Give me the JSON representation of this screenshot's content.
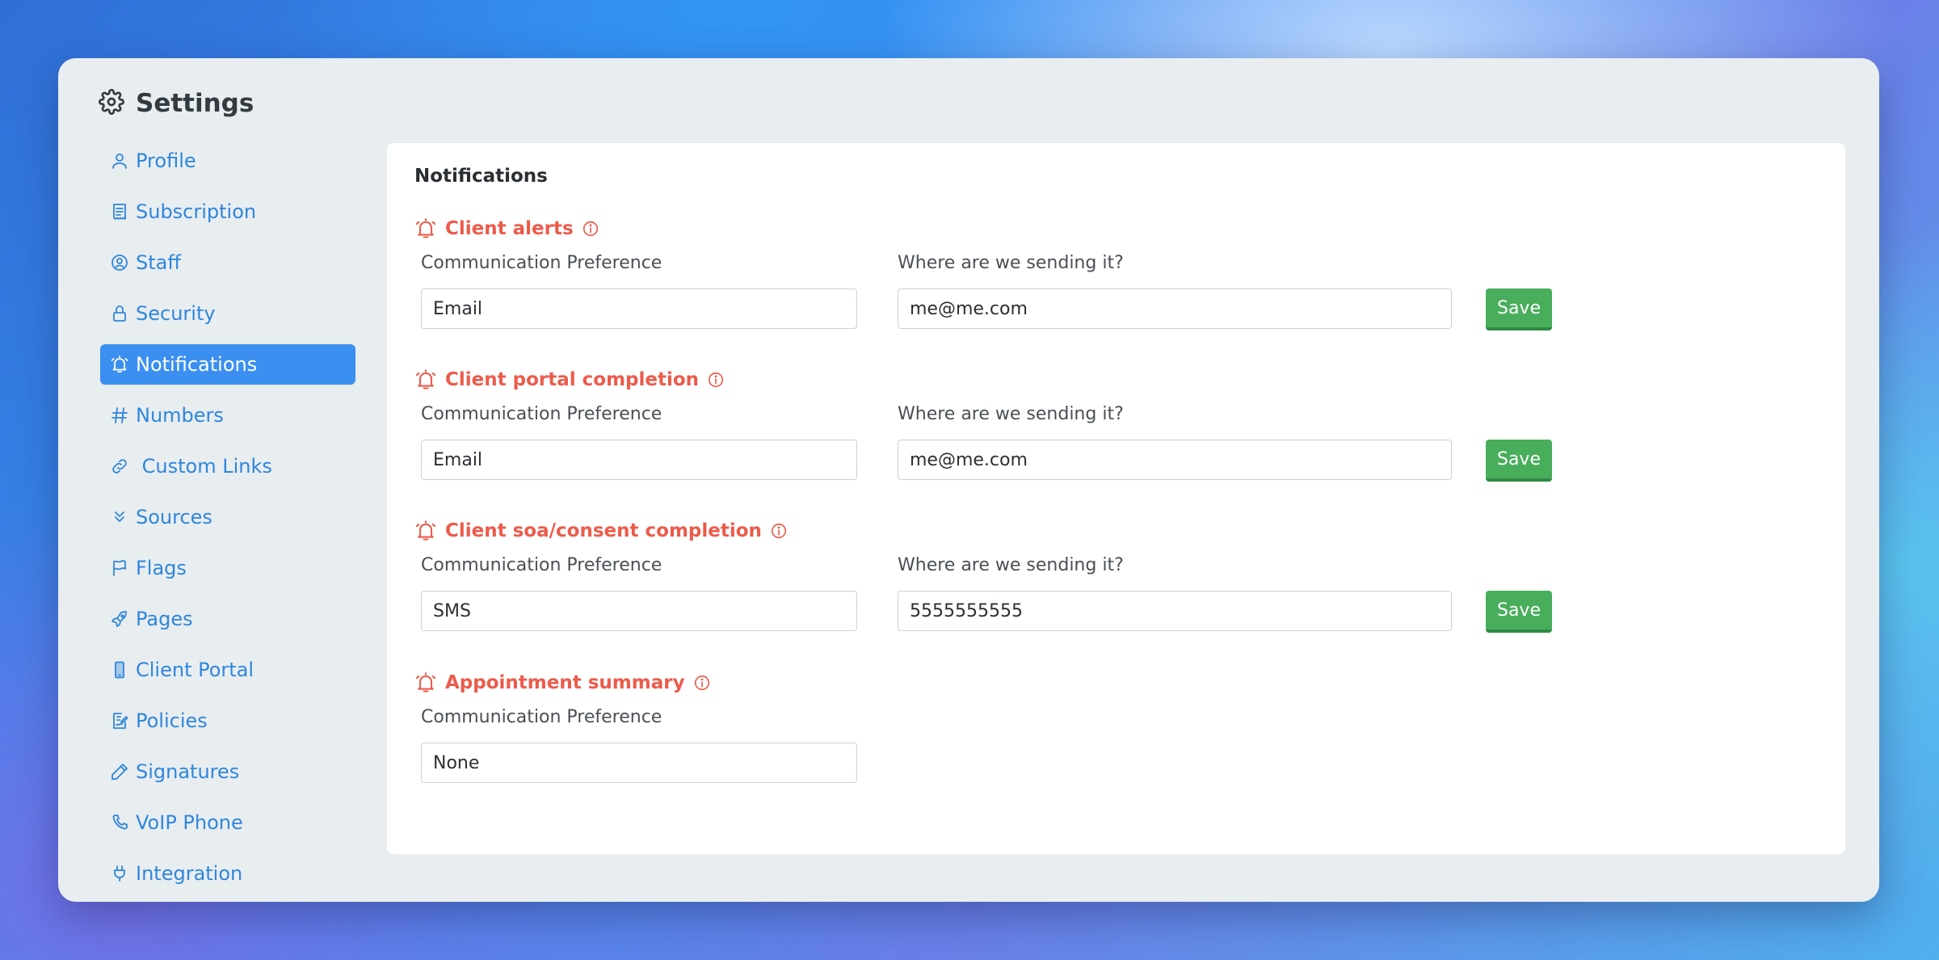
{
  "app": {
    "title": "Settings"
  },
  "sidebar": {
    "items": [
      {
        "label": "Profile",
        "icon": "person-icon"
      },
      {
        "label": "Subscription",
        "icon": "receipt-icon"
      },
      {
        "label": "Staff",
        "icon": "user-circle-icon"
      },
      {
        "label": "Security",
        "icon": "lock-icon"
      },
      {
        "label": "Notifications",
        "icon": "bell-icon",
        "active": true
      },
      {
        "label": "Numbers",
        "icon": "hash-icon"
      },
      {
        "label": " Custom Links",
        "icon": "link-icon"
      },
      {
        "label": "Sources",
        "icon": "chevron-double-down-icon"
      },
      {
        "label": "Flags",
        "icon": "flag-icon"
      },
      {
        "label": "Pages",
        "icon": "rocket-icon"
      },
      {
        "label": "Client Portal",
        "icon": "phone-icon"
      },
      {
        "label": "Policies",
        "icon": "signed-document-icon"
      },
      {
        "label": "Signatures",
        "icon": "pencil-icon"
      },
      {
        "label": "VoIP Phone",
        "icon": "telephone-icon"
      },
      {
        "label": "Integration",
        "icon": "plug-icon"
      }
    ]
  },
  "main": {
    "title": "Notifications",
    "sections": [
      {
        "title": "Client alerts",
        "pref_label": "Communication Preference",
        "pref_value": "Email",
        "dest_label": "Where are we sending it?",
        "dest_value": "me@me.com",
        "save_label": "Save"
      },
      {
        "title": "Client portal completion",
        "pref_label": "Communication Preference",
        "pref_value": "Email",
        "dest_label": "Where are we sending it?",
        "dest_value": "me@me.com",
        "save_label": "Save"
      },
      {
        "title": "Client soa/consent completion",
        "pref_label": "Communication Preference",
        "pref_value": "SMS",
        "dest_label": "Where are we sending it?",
        "dest_value": "5555555555",
        "save_label": "Save"
      },
      {
        "title": "Appointment summary",
        "pref_label": "Communication Preference",
        "pref_value": "None"
      }
    ]
  },
  "colors": {
    "accent": "#3b8ff0",
    "link": "#2f86dc",
    "alert": "#ec5b4b",
    "save": "#48ae5c"
  }
}
